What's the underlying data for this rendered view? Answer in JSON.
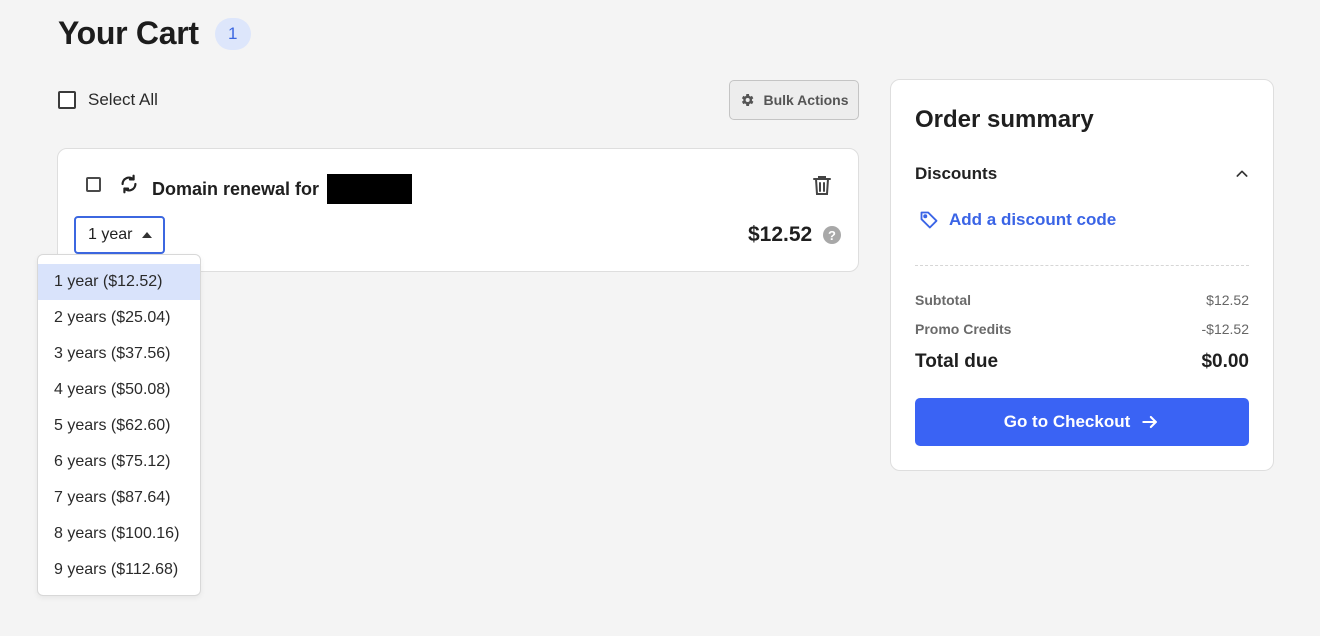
{
  "header": {
    "title": "Your Cart",
    "item_count": "1"
  },
  "toolbar": {
    "select_all_label": "Select All",
    "bulk_actions_label": "Bulk Actions"
  },
  "cart_items": [
    {
      "title": "Domain renewal for",
      "period_selected": "1 year",
      "price": "$12.52",
      "help_glyph": "?"
    }
  ],
  "period_options": [
    "1 year ($12.52)",
    "2 years ($25.04)",
    "3 years ($37.56)",
    "4 years ($50.08)",
    "5 years ($62.60)",
    "6 years ($75.12)",
    "7 years ($87.64)",
    "8 years ($100.16)",
    "9 years ($112.68)"
  ],
  "summary": {
    "title": "Order summary",
    "discounts_label": "Discounts",
    "add_discount_label": "Add a discount code",
    "subtotal_label": "Subtotal",
    "subtotal_value": "$12.52",
    "promo_label": "Promo Credits",
    "promo_value": "-$12.52",
    "total_label": "Total due",
    "total_value": "$0.00",
    "checkout_label": "Go to Checkout"
  },
  "colors": {
    "accent": "#3a63f4",
    "link": "#3a64e6",
    "badge_bg": "#dde6fb",
    "selected_option_bg": "#d9e3fb"
  },
  "icons": [
    "gear-icon",
    "renew-icon",
    "trash-icon",
    "help-icon",
    "chevron-up-icon",
    "tag-icon",
    "arrow-right-icon",
    "caret-up-icon"
  ]
}
